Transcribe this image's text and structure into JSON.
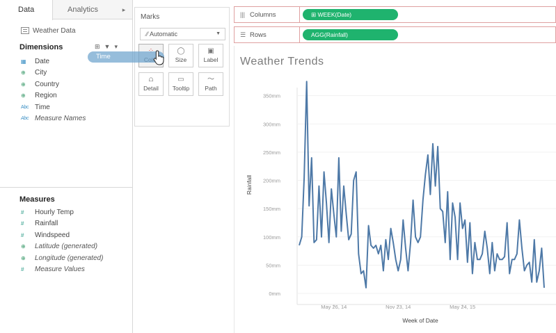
{
  "left_pane": {
    "tabs": {
      "data": "Data",
      "analytics": "Analytics",
      "arrow": "▸"
    },
    "datasource": "Weather Data",
    "dimensions_title": "Dimensions",
    "dimension_tools": [
      "⊞",
      "▼",
      "▾"
    ],
    "dimensions": [
      {
        "icon": "calendar-icon",
        "glyph": "▦",
        "cls": "date",
        "label": "Date",
        "italic": false
      },
      {
        "icon": "globe-icon",
        "glyph": "⊕",
        "cls": "globe",
        "label": "City",
        "italic": false
      },
      {
        "icon": "globe-icon",
        "glyph": "⊕",
        "cls": "globe",
        "label": "Country",
        "italic": false
      },
      {
        "icon": "globe-icon",
        "glyph": "⊕",
        "cls": "globe",
        "label": "Region",
        "italic": false
      },
      {
        "icon": "abc-icon",
        "glyph": "Abc",
        "cls": "abc",
        "label": "Time",
        "italic": false
      },
      {
        "icon": "abc-icon",
        "glyph": "Abc",
        "cls": "abc",
        "label": "Measure Names",
        "italic": true
      }
    ],
    "measures_title": "Measures",
    "measures": [
      {
        "icon": "measure-icon",
        "glyph": "#",
        "cls": "measure",
        "label": "Hourly Temp",
        "italic": false
      },
      {
        "icon": "measure-icon",
        "glyph": "#",
        "cls": "measure",
        "label": "Rainfall",
        "italic": false
      },
      {
        "icon": "measure-icon",
        "glyph": "#",
        "cls": "measure",
        "label": "Windspeed",
        "italic": false
      },
      {
        "icon": "globe-icon",
        "glyph": "⊕",
        "cls": "globe",
        "label": "Latitude (generated)",
        "italic": true
      },
      {
        "icon": "globe-icon",
        "glyph": "⊕",
        "cls": "globe",
        "label": "Longitude (generated)",
        "italic": true
      },
      {
        "icon": "measure-icon",
        "glyph": "#",
        "cls": "measure",
        "label": "Measure Values",
        "italic": true
      }
    ]
  },
  "marks": {
    "title": "Marks",
    "mark_type": "Automatic",
    "buttons": [
      {
        "label": "Color",
        "glyph": "⁘",
        "icon": "color-icon"
      },
      {
        "label": "Size",
        "glyph": "◯",
        "icon": "size-icon"
      },
      {
        "label": "Label",
        "glyph": "▣",
        "icon": "label-icon"
      },
      {
        "label": "Detail",
        "glyph": "⩍",
        "icon": "detail-icon"
      },
      {
        "label": "Tooltip",
        "glyph": "▭",
        "icon": "tooltip-icon"
      },
      {
        "label": "Path",
        "glyph": "〜",
        "icon": "path-icon"
      }
    ]
  },
  "drag_pill": "Time",
  "shelves": {
    "columns": {
      "label": "Columns",
      "pill": "WEEK(Date)"
    },
    "rows": {
      "label": "Rows",
      "pill": "AGG(Rainfall)"
    }
  },
  "viz_title": "Weather Trends",
  "colors": {
    "line": "#4e79a7",
    "pill_green": "#1fb36e",
    "drag_pill": "#6da4cd",
    "shelf_border": "#dfa0a0"
  },
  "chart_data": {
    "type": "line",
    "title": "Weather Trends",
    "xlabel": "Week of Date",
    "ylabel": "Rainfall",
    "ylim": [
      0,
      400
    ],
    "y_ticks": [
      0,
      50,
      100,
      150,
      200,
      250,
      300,
      350
    ],
    "y_tick_labels": [
      "0mm",
      "50mm",
      "100mm",
      "150mm",
      "200mm",
      "250mm",
      "300mm",
      "350mm"
    ],
    "x_tick_labels": [
      "May 26, 14",
      "Nov 23, 14",
      "May 24, 15"
    ],
    "x_tick_index": [
      14,
      40,
      66
    ],
    "grid": "y-axis",
    "series": [
      {
        "values": [
          85,
          100,
          205,
          375,
          155,
          240,
          90,
          95,
          190,
          100,
          215,
          160,
          90,
          185,
          140,
          100,
          240,
          110,
          190,
          140,
          95,
          105,
          200,
          215,
          70,
          35,
          40,
          10,
          120,
          85,
          80,
          85,
          70,
          85,
          40,
          95,
          60,
          115,
          90,
          60,
          40,
          60,
          130,
          80,
          40,
          90,
          165,
          100,
          90,
          100,
          165,
          210,
          245,
          175,
          265,
          190,
          260,
          150,
          145,
          90,
          180,
          60,
          160,
          135,
          60,
          160,
          115,
          130,
          55,
          125,
          35,
          90,
          60,
          60,
          70,
          110,
          80,
          35,
          90,
          40,
          70,
          60,
          60,
          65,
          125,
          35,
          60,
          60,
          70,
          130,
          80,
          40,
          50,
          55,
          20,
          95,
          20,
          40,
          80,
          10
        ]
      }
    ]
  }
}
